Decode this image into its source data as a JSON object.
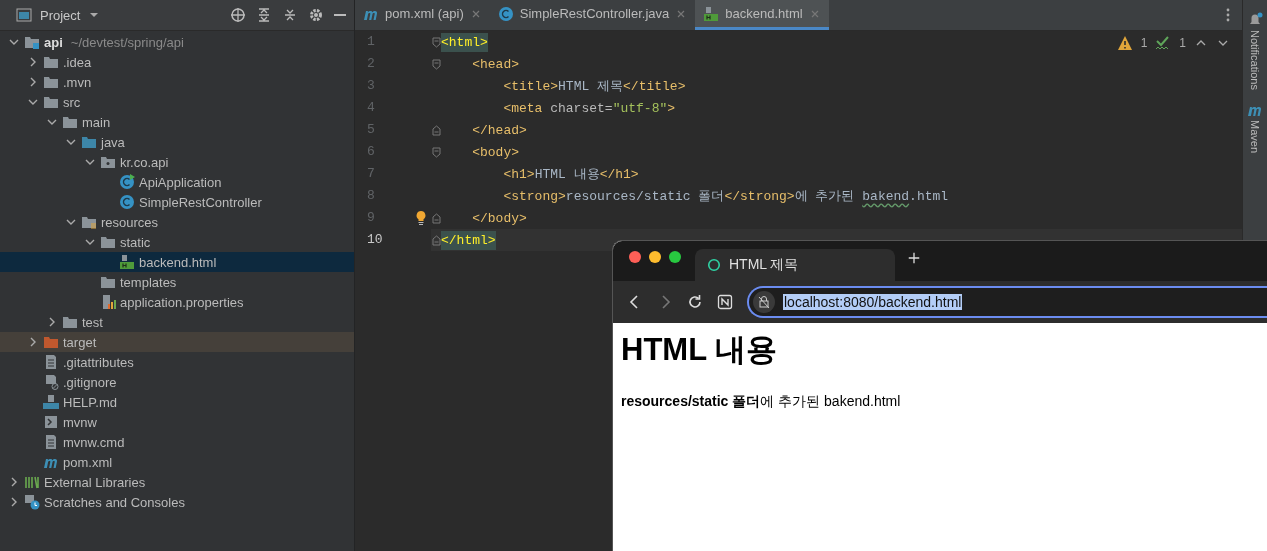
{
  "project_panel": {
    "title": "Project",
    "tree": [
      {
        "label": "api",
        "hint": "~/devtest/spring/api",
        "kind": "module",
        "expanded": true,
        "selected": false,
        "children": [
          {
            "label": ".idea",
            "kind": "folder",
            "expanded": false,
            "selected": false
          },
          {
            "label": ".mvn",
            "kind": "folder",
            "expanded": false,
            "selected": false
          },
          {
            "label": "src",
            "kind": "folder",
            "expanded": true,
            "selected": false,
            "children": [
              {
                "label": "main",
                "kind": "folder",
                "expanded": true,
                "selected": false,
                "children": [
                  {
                    "label": "java",
                    "kind": "folder-source",
                    "expanded": true,
                    "selected": false,
                    "children": [
                      {
                        "label": "kr.co.api",
                        "kind": "package",
                        "expanded": true,
                        "selected": false,
                        "children": [
                          {
                            "label": "ApiApplication",
                            "kind": "class-run",
                            "selected": false
                          },
                          {
                            "label": "SimpleRestController",
                            "kind": "class",
                            "selected": false
                          }
                        ]
                      }
                    ]
                  },
                  {
                    "label": "resources",
                    "kind": "folder-resources",
                    "expanded": true,
                    "selected": false,
                    "children": [
                      {
                        "label": "static",
                        "kind": "folder",
                        "expanded": true,
                        "selected": false,
                        "children": [
                          {
                            "label": "backend.html",
                            "kind": "html",
                            "selected": true
                          }
                        ]
                      },
                      {
                        "label": "templates",
                        "kind": "folder",
                        "selected": false
                      },
                      {
                        "label": "application.properties",
                        "kind": "properties",
                        "selected": false
                      }
                    ]
                  }
                ]
              },
              {
                "label": "test",
                "kind": "folder",
                "expanded": false,
                "selected": false
              }
            ]
          },
          {
            "label": "target",
            "kind": "folder-excluded",
            "expanded": false,
            "selected": false
          },
          {
            "label": ".gitattributes",
            "kind": "text",
            "selected": false
          },
          {
            "label": ".gitignore",
            "kind": "gitignore",
            "selected": false
          },
          {
            "label": "HELP.md",
            "kind": "md",
            "selected": false
          },
          {
            "label": "mvnw",
            "kind": "shell",
            "selected": false
          },
          {
            "label": "mvnw.cmd",
            "kind": "text",
            "selected": false
          },
          {
            "label": "pom.xml",
            "kind": "maven",
            "selected": false
          }
        ]
      },
      {
        "label": "External Libraries",
        "kind": "libraries",
        "expanded": false,
        "selected": false
      },
      {
        "label": "Scratches and Consoles",
        "kind": "scratches",
        "expanded": false,
        "selected": false
      }
    ]
  },
  "editor": {
    "tabs": [
      {
        "label": "pom.xml (api)",
        "kind": "maven",
        "selected": false
      },
      {
        "label": "SimpleRestController.java",
        "kind": "class",
        "selected": false
      },
      {
        "label": "backend.html",
        "kind": "html",
        "selected": true
      }
    ],
    "inspections": {
      "warnings": "1",
      "typos": "1"
    },
    "lines": [
      {
        "number": "1",
        "current": false,
        "kind": "fold-start",
        "bulb": false,
        "tokens": [
          {
            "kind": "tag-match",
            "text": "<html>"
          }
        ]
      },
      {
        "number": "2",
        "current": false,
        "kind": "fold-start",
        "bulb": false,
        "tokens": [
          {
            "kind": "tag",
            "text": "    <head>"
          }
        ]
      },
      {
        "number": "3",
        "current": false,
        "kind": "plain",
        "bulb": false,
        "tokens": [
          {
            "kind": "tag",
            "text": "        <title>"
          },
          {
            "kind": "text",
            "text": "HTML 제목"
          },
          {
            "kind": "tag",
            "text": "</title>"
          }
        ]
      },
      {
        "number": "4",
        "current": false,
        "kind": "plain",
        "bulb": false,
        "tokens": [
          {
            "kind": "tag",
            "text": "        <meta "
          },
          {
            "kind": "attr",
            "text": "charset="
          },
          {
            "kind": "string",
            "text": "\"utf-8\""
          },
          {
            "kind": "tag",
            "text": ">"
          }
        ]
      },
      {
        "number": "5",
        "current": false,
        "kind": "fold-end",
        "bulb": false,
        "tokens": [
          {
            "kind": "tag",
            "text": "    </head>"
          }
        ]
      },
      {
        "number": "6",
        "current": false,
        "kind": "fold-start",
        "bulb": false,
        "tokens": [
          {
            "kind": "tag",
            "text": "    <body>"
          }
        ]
      },
      {
        "number": "7",
        "current": false,
        "kind": "plain",
        "bulb": false,
        "tokens": [
          {
            "kind": "tag",
            "text": "        <h1>"
          },
          {
            "kind": "text",
            "text": "HTML 내용"
          },
          {
            "kind": "tag",
            "text": "</h1>"
          }
        ]
      },
      {
        "number": "8",
        "current": false,
        "kind": "plain",
        "bulb": false,
        "tokens": [
          {
            "kind": "tag",
            "text": "        <strong>"
          },
          {
            "kind": "text",
            "text": "resources/static 폴더"
          },
          {
            "kind": "tag",
            "text": "</strong>"
          },
          {
            "kind": "text",
            "text": "에 추가된 "
          },
          {
            "kind": "typo",
            "text": "bakend"
          },
          {
            "kind": "text",
            "text": ".html"
          }
        ]
      },
      {
        "number": "9",
        "current": false,
        "kind": "fold-end",
        "bulb": true,
        "tokens": [
          {
            "kind": "tag",
            "text": "    </body>"
          }
        ]
      },
      {
        "number": "10",
        "current": true,
        "kind": "fold-end",
        "bulb": false,
        "tokens": [
          {
            "kind": "tag-match",
            "text": "</html>"
          }
        ]
      }
    ]
  },
  "side_strip": [
    {
      "label": "Notifications",
      "kind": "bell"
    },
    {
      "label": "Maven",
      "kind": "maven"
    }
  ],
  "browser": {
    "tab": {
      "title": "HTML 제목"
    },
    "address": "localhost:8080/backend.html",
    "page": {
      "heading": "HTML 내용",
      "paragraph": "**resources/static 폴더**에 추가된 bakend.html"
    }
  }
}
